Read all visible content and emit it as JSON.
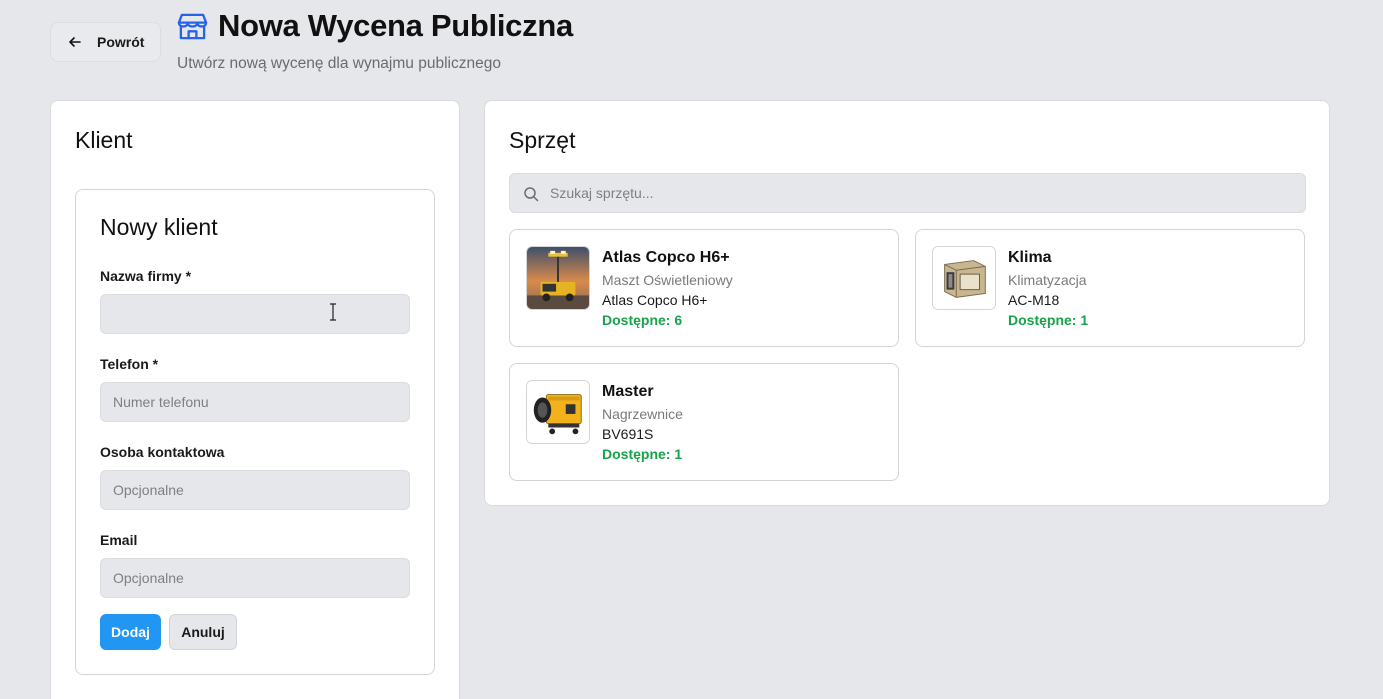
{
  "header": {
    "back_label": "Powrót",
    "title": "Nowa Wycena Publiczna",
    "subtitle": "Utwórz nową wycenę dla wynajmu publicznego",
    "title_icon": "store-icon",
    "accent_color": "#2563eb"
  },
  "client": {
    "section_title": "Klient",
    "form_title": "Nowy klient",
    "fields": [
      {
        "label": "Nazwa firmy *",
        "placeholder": "",
        "value": ""
      },
      {
        "label": "Telefon *",
        "placeholder": "Numer telefonu",
        "value": ""
      },
      {
        "label": "Osoba kontaktowa",
        "placeholder": "Opcjonalne",
        "value": ""
      },
      {
        "label": "Email",
        "placeholder": "Opcjonalne",
        "value": ""
      }
    ],
    "add_label": "Dodaj",
    "cancel_label": "Anuluj",
    "primary_color": "#2196f3"
  },
  "equipment": {
    "section_title": "Sprzęt",
    "search_placeholder": "Szukaj sprzętu...",
    "available_color": "#16a34a",
    "items": [
      {
        "name": "Atlas Copco H6+",
        "category": "Maszt Oświetleniowy",
        "model": "Atlas Copco H6+",
        "availability": "Dostępne: 6",
        "image": "light-tower-image"
      },
      {
        "name": "Klima",
        "category": "Klimatyzacja",
        "model": "AC-M18",
        "availability": "Dostępne: 1",
        "image": "air-conditioner-image"
      },
      {
        "name": "Master",
        "category": "Nagrzewnice",
        "model": "BV691S",
        "availability": "Dostępne: 1",
        "image": "heater-image"
      }
    ]
  }
}
